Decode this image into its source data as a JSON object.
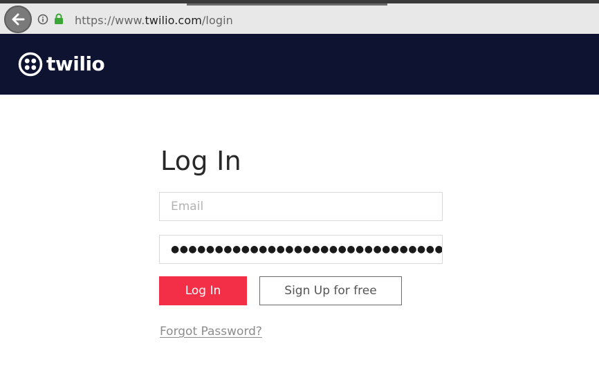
{
  "browser": {
    "url_scheme": "https://www.",
    "url_host": "twilio.com",
    "url_path": "/login",
    "back_icon": "arrow-left-icon",
    "info_icon": "info-circle-icon",
    "lock_icon": "padlock-icon"
  },
  "header": {
    "logo_text": "twilio",
    "logo_icon": "twilio-logo-mark",
    "background": "#0d1330"
  },
  "login": {
    "title": "Log In",
    "email_placeholder": "Email",
    "email_value": "",
    "password_value": "●●●●●●●●●●●●●●●●●●●●●●●●●●●●●●●",
    "login_label": "Log In",
    "signup_label": "Sign Up for free",
    "forgot_label": "Forgot Password?",
    "accent": "#f22f46"
  }
}
